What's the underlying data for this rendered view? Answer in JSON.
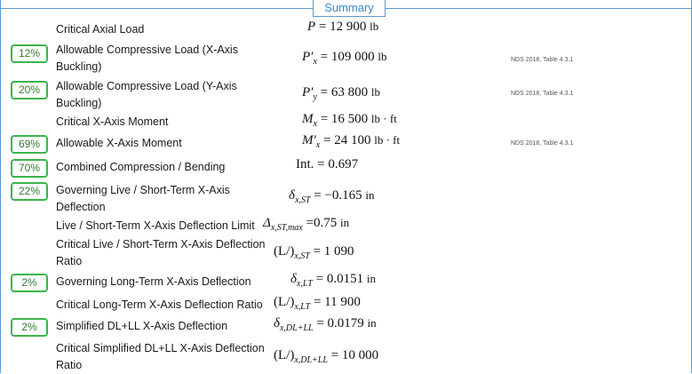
{
  "header": {
    "tab_label": "Summary"
  },
  "rows": [
    {
      "label": "Critical Axial Load",
      "badge": "",
      "sym": "P",
      "sub": "",
      "op": "=",
      "value": "12 900",
      "unit": "lb",
      "ref": ""
    },
    {
      "label": "Allowable Compressive Load (X-Axis Buckling)",
      "badge": "12%",
      "sym": "P′",
      "sub": "x",
      "op": "=",
      "value": "109 000",
      "unit": "lb",
      "ref": "NDS 2018, Table 4.3.1"
    },
    {
      "label": "Allowable Compressive Load (Y-Axis Buckling)",
      "badge": "20%",
      "sym": "P′",
      "sub": "y",
      "op": "=",
      "value": "63 800",
      "unit": "lb",
      "ref": "NDS 2018, Table 4.3.1"
    },
    {
      "label": "Critical X-Axis Moment",
      "badge": "",
      "sym": "M",
      "sub": "x",
      "op": "=",
      "value": "16 500",
      "unit": "lb · ft",
      "ref": ""
    },
    {
      "label": "Allowable X-Axis Moment",
      "badge": "69%",
      "sym": "M′",
      "sub": "x",
      "op": "=",
      "value": "24 100",
      "unit": "lb · ft",
      "ref": "NDS 2018, Table 4.3.1"
    },
    {
      "label": "Combined Compression / Bending",
      "badge": "70%",
      "sym": "Int.",
      "sub": "",
      "op": "=",
      "value": "0.697",
      "unit": "",
      "ref": ""
    },
    {
      "label": "Governing Live / Short-Term X-Axis Deflection",
      "badge": "22%",
      "sym": "δ",
      "sub": "x,ST",
      "op": "=",
      "value": "−0.165",
      "unit": "in",
      "ref": ""
    },
    {
      "label": "Live / Short-Term X-Axis Deflection Limit",
      "badge": "",
      "sym": "Δ",
      "sub": "x,ST,max",
      "op": "=",
      "value": "0.75",
      "unit": "in",
      "ref": ""
    },
    {
      "label": "Critical Live / Short-Term X-Axis Deflection Ratio",
      "badge": "",
      "sym": "(L/)",
      "sub": "x,ST",
      "op": "=",
      "value": "1 090",
      "unit": "",
      "ref": ""
    },
    {
      "label": "Governing Long-Term X-Axis Deflection",
      "badge": "2%",
      "sym": "δ",
      "sub": "x,LT",
      "op": "=",
      "value": "0.0151",
      "unit": "in",
      "ref": ""
    },
    {
      "label": "Critical Long-Term X-Axis Deflection Ratio",
      "badge": "",
      "sym": "(L/)",
      "sub": "x,LT",
      "op": "=",
      "value": "11 900",
      "unit": "",
      "ref": ""
    },
    {
      "label": "Simplified DL+LL X-Axis Deflection",
      "badge": "2%",
      "sym": "δ",
      "sub": "x,DL+LL",
      "op": "=",
      "value": "0.0179",
      "unit": "in",
      "ref": ""
    },
    {
      "label": "Critical Simplified DL+LL X-Axis Deflection Ratio",
      "badge": "",
      "sym": "(L/)",
      "sub": "x,DL+LL",
      "op": "=",
      "value": "10 000",
      "unit": "",
      "ref": ""
    }
  ]
}
